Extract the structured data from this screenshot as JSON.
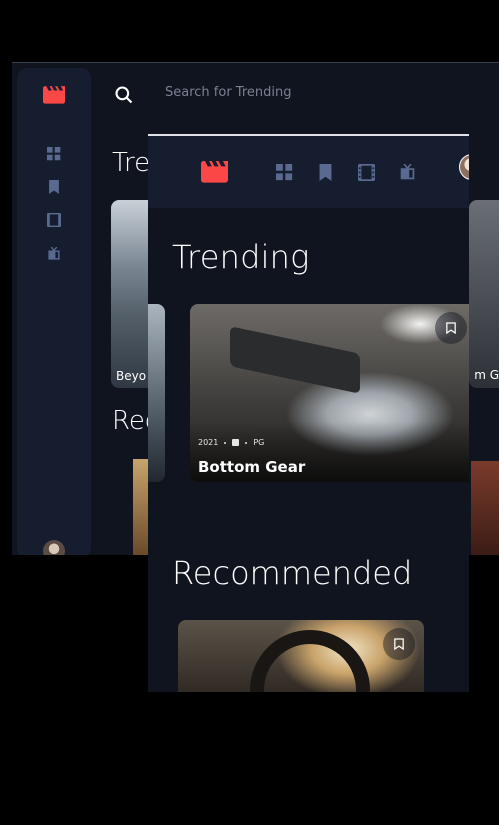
{
  "back_window": {
    "search_placeholder": "Search for Trending",
    "title_trending_partial": "Tre",
    "title_recommended_partial": "Rec",
    "card_left_title_partial": "Beyo",
    "card_right_title_partial": "m G",
    "accent_color": "#fc4747",
    "icons": [
      "logo-icon",
      "home-grid-icon",
      "bookmark-icon",
      "movie-icon",
      "tv-icon",
      "search-icon"
    ]
  },
  "front_window": {
    "accent_color": "#fc4747",
    "nav_icons": [
      "home-grid-icon",
      "bookmark-icon",
      "movie-icon",
      "tv-icon"
    ],
    "trending_title": "Trending",
    "recommended_title": "Recommended",
    "trending_card": {
      "year": "2021",
      "rating": "PG",
      "title": "Bottom Gear"
    }
  }
}
